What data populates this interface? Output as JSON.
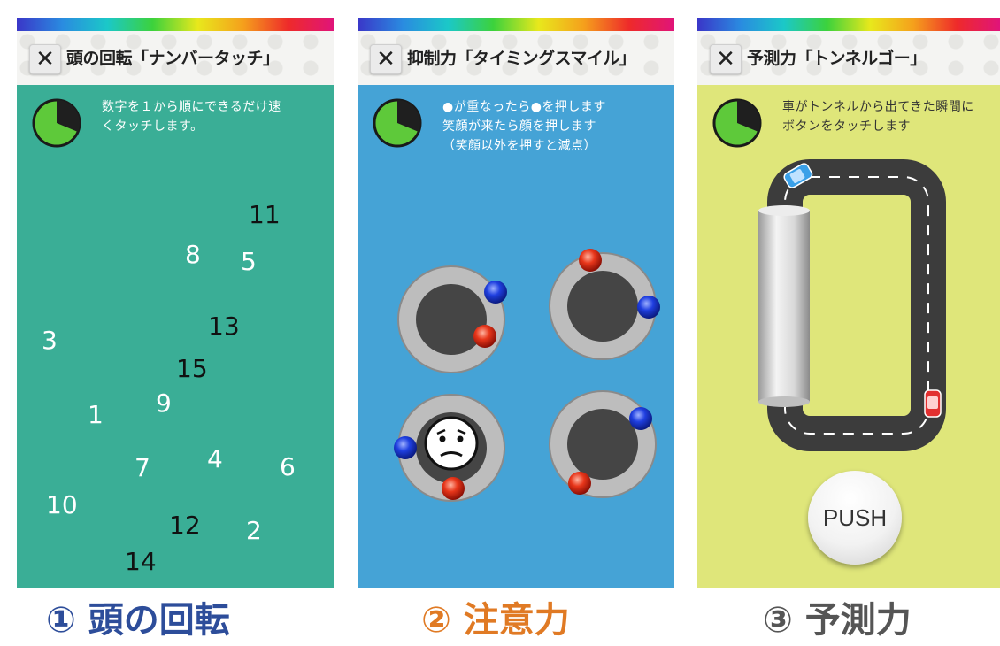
{
  "colors": {
    "panel1_bg": "#3aae96",
    "panel2_bg": "#45a3d6",
    "panel3_bg": "#dfe67a",
    "caption1": "#2d4d9a",
    "caption2": "#e07a24",
    "caption3": "#555555"
  },
  "panels": [
    {
      "close_icon": "✕",
      "title": "頭の回転「ナンバータッチ」",
      "instructions": "数字を１から順にできるだけ速\nくタッチします。",
      "numbers": [
        {
          "label": "11",
          "color": "black"
        },
        {
          "label": "8",
          "color": "white"
        },
        {
          "label": "5",
          "color": "white"
        },
        {
          "label": "3",
          "color": "white"
        },
        {
          "label": "13",
          "color": "black"
        },
        {
          "label": "15",
          "color": "black"
        },
        {
          "label": "9",
          "color": "white"
        },
        {
          "label": "1",
          "color": "white"
        },
        {
          "label": "7",
          "color": "white"
        },
        {
          "label": "4",
          "color": "white"
        },
        {
          "label": "6",
          "color": "white"
        },
        {
          "label": "10",
          "color": "white"
        },
        {
          "label": "12",
          "color": "black"
        },
        {
          "label": "2",
          "color": "white"
        },
        {
          "label": "14",
          "color": "black"
        }
      ]
    },
    {
      "close_icon": "✕",
      "title": "抑制力「タイミングスマイル」",
      "instructions": "●が重なったら●を押します\n笑顔が来たら顔を押します\n（笑顔以外を押すと減点）",
      "targets": [
        "dial-1",
        "dial-2",
        "dial-3-face",
        "dial-4"
      ]
    },
    {
      "close_icon": "✕",
      "title": "予測力「トンネルゴー」",
      "instructions": "車がトンネルから出てきた瞬間に\nボタンをタッチします",
      "push_label": "PUSH"
    }
  ],
  "captions": [
    "① 頭の回転",
    "② 注意力",
    "③ 予測力"
  ]
}
